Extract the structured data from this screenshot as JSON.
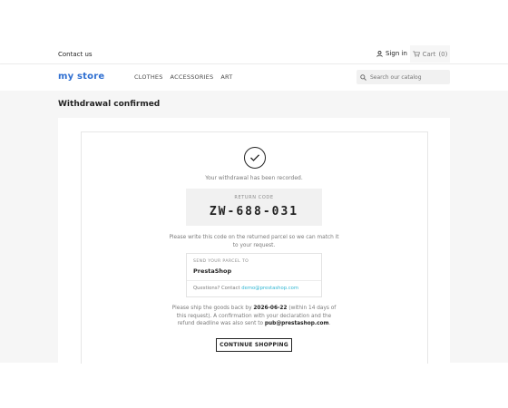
{
  "topbar": {
    "contact_label": "Contact us",
    "signin_icon": "user-icon",
    "signin_label": "Sign in",
    "cart_icon": "shopping-cart-icon",
    "cart_label": "Cart",
    "cart_count": "(0)"
  },
  "header": {
    "logo_text": "my store",
    "nav": [
      "CLOTHES",
      "ACCESSORIES",
      "ART"
    ],
    "search_icon": "search-icon",
    "search_placeholder": "Search our catalog"
  },
  "page": {
    "title": "Withdrawal confirmed"
  },
  "confirmation": {
    "check_icon": "check-circle-icon",
    "recorded_text": "Your withdrawal has been recorded.",
    "code_label": "RETURN CODE",
    "code_value": "ZW-688-031",
    "write_text": "Please write this code on the returned parcel so we can match it to your request.",
    "parcel_label": "SEND YOUR PARCEL TO",
    "parcel_name": "PrestaShop",
    "questions_prefix": "Questions? Contact",
    "questions_email": "demo@prestashop.com",
    "ship_prefix": "Please ship the goods back by",
    "ship_date": "2026-06-22",
    "ship_middle": "(within 14 days of this request). A confirmation with your declaration and the refund deadline was also sent to",
    "ship_email": "pub@prestashop.com",
    "ship_suffix": ".",
    "continue_label": "CONTINUE SHOPPING"
  },
  "colors": {
    "brand_blue": "#2f6fd1",
    "brand_orange": "#f39d72",
    "link": "#2fb5d2",
    "background": "#f6f6f6"
  }
}
